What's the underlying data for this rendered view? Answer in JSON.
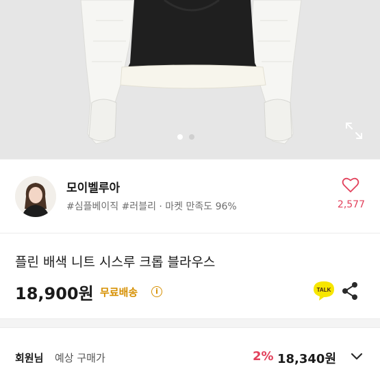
{
  "carousel": {
    "total_images": 2,
    "active_index": 0
  },
  "seller": {
    "name": "모이벨루아",
    "tags": "#심플베이직 #러블리 · 마켓 만족도 96%",
    "like_count": "2,577"
  },
  "product": {
    "title": "플린 배색 니트 시스루 크롭 블라우스",
    "price": "18,900원",
    "shipping": "무료배송",
    "info_glyph": "i",
    "talk_label": "TALK"
  },
  "member": {
    "label": "회원님",
    "sub": "예상 구매가",
    "discount": "2%",
    "price": "18,340원"
  },
  "colors": {
    "accent_pink": "#e2405b",
    "shipping_gold": "#d68f00",
    "talk_yellow": "#f7e600"
  },
  "icons": [
    "expand-icon",
    "heart-icon",
    "kakao-talk-icon",
    "share-icon",
    "info-icon",
    "chevron-down-icon"
  ]
}
